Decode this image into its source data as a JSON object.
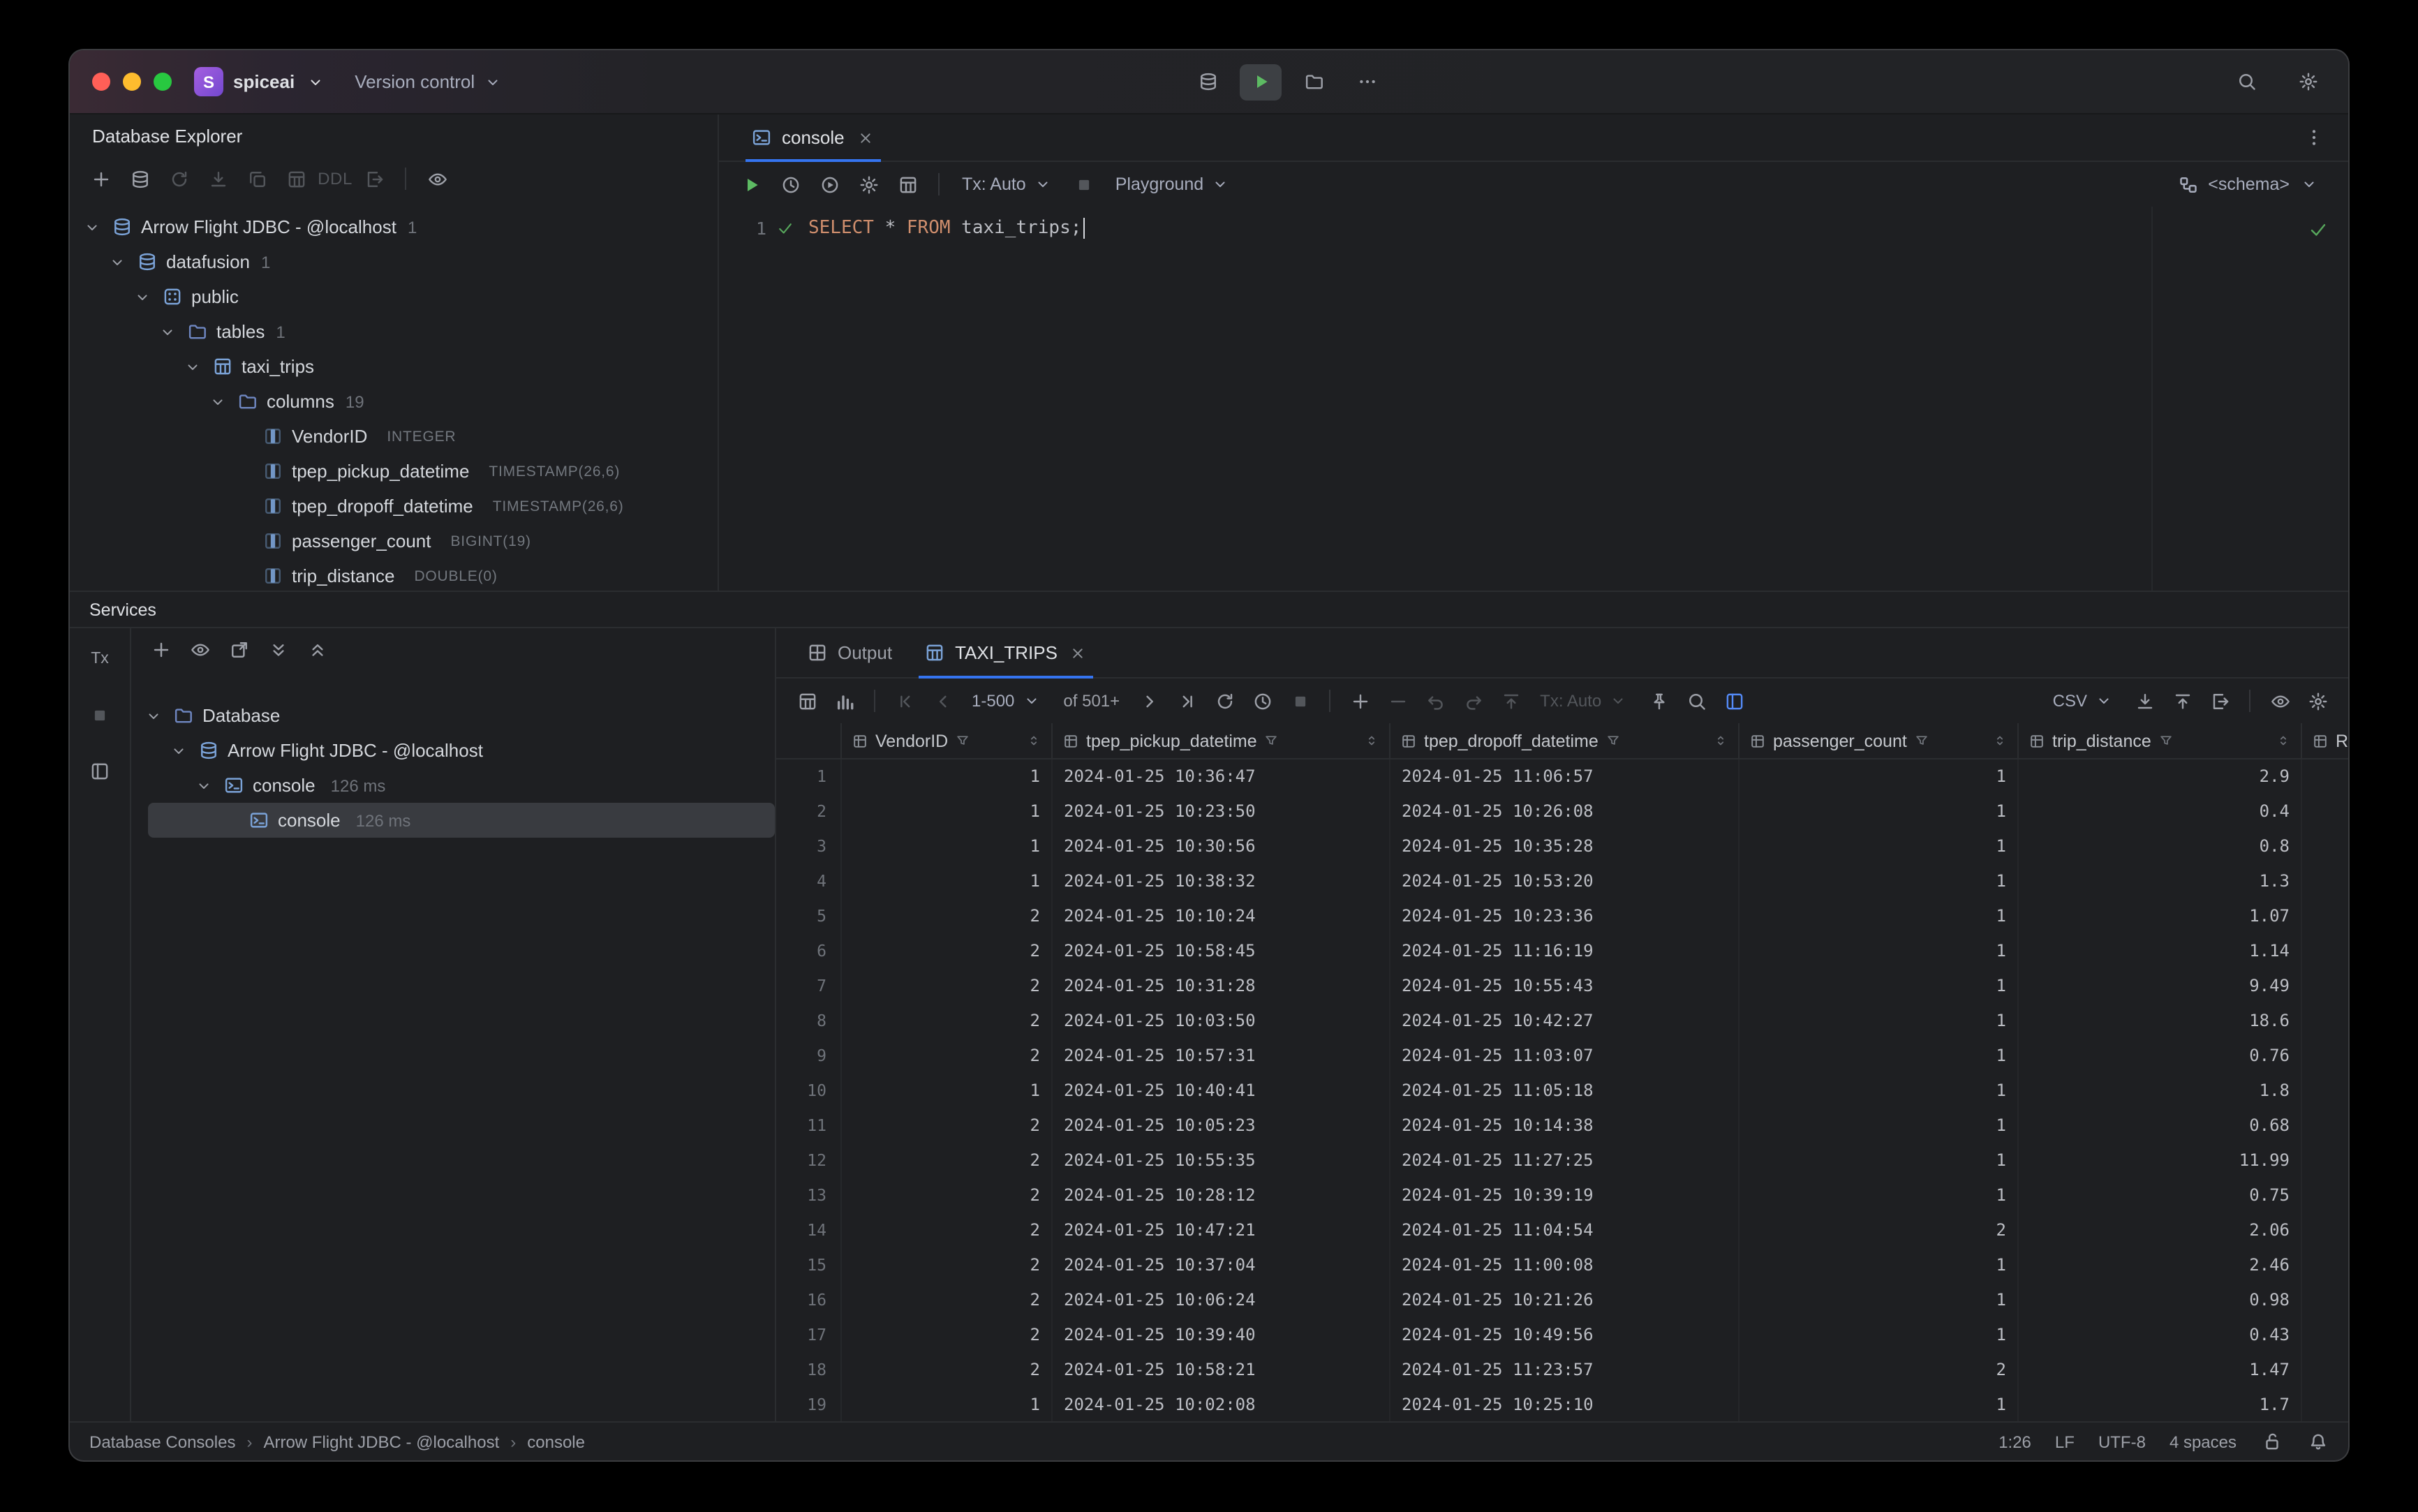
{
  "titlebar": {
    "project_initial": "S",
    "project_name": "spiceai",
    "version_control": "Version control"
  },
  "database_explorer": {
    "title": "Database Explorer",
    "toolbar": {
      "ddl": "DDL"
    },
    "tree": [
      {
        "icon": "db",
        "label": "Arrow Flight JDBC - @localhost",
        "badge": "1",
        "level": 0,
        "expanded": true
      },
      {
        "icon": "db",
        "label": "datafusion",
        "badge": "1",
        "level": 1,
        "expanded": true
      },
      {
        "icon": "schema",
        "label": "public",
        "level": 2,
        "expanded": true
      },
      {
        "icon": "folder",
        "label": "tables",
        "badge": "1",
        "level": 3,
        "expanded": true
      },
      {
        "icon": "table",
        "label": "taxi_trips",
        "level": 4,
        "expanded": true
      },
      {
        "icon": "folder",
        "label": "columns",
        "badge": "19",
        "level": 5,
        "expanded": true
      },
      {
        "icon": "column",
        "label": "VendorID",
        "type": "INTEGER",
        "level": 6
      },
      {
        "icon": "column",
        "label": "tpep_pickup_datetime",
        "type": "TIMESTAMP(26,6)",
        "level": 6
      },
      {
        "icon": "column",
        "label": "tpep_dropoff_datetime",
        "type": "TIMESTAMP(26,6)",
        "level": 6
      },
      {
        "icon": "column",
        "label": "passenger_count",
        "type": "BIGINT(19)",
        "level": 6
      },
      {
        "icon": "column",
        "label": "trip_distance",
        "type": "DOUBLE(0)",
        "level": 6
      }
    ]
  },
  "editor": {
    "tab": "console",
    "toolbar": {
      "tx": "Tx: Auto",
      "playground": "Playground",
      "schema": "<schema>"
    },
    "line_number": "1",
    "code": {
      "kw1": "SELECT",
      "op": " * ",
      "kw2": "FROM",
      "ident": " taxi_trips",
      "semi": ";"
    }
  },
  "services": {
    "title": "Services",
    "strip_tx": "Tx",
    "tree": [
      {
        "icon": "folder",
        "label": "Database",
        "level": 0,
        "expanded": true
      },
      {
        "icon": "db",
        "label": "Arrow Flight JDBC - @localhost",
        "level": 1,
        "expanded": true
      },
      {
        "icon": "terminal",
        "label": "console",
        "meta": "126 ms",
        "level": 2,
        "expanded": true
      },
      {
        "icon": "terminal",
        "label": "console",
        "meta": "126 ms",
        "level": 3,
        "selected": true
      }
    ]
  },
  "results": {
    "tabs": {
      "output": "Output",
      "result": "TAXI_TRIPS"
    },
    "toolbar": {
      "page": "1-500",
      "of": "of 501+",
      "tx": "Tx: Auto",
      "format": "CSV"
    },
    "grid": {
      "columns": [
        {
          "label": "VendorID",
          "align": "right"
        },
        {
          "label": "tpep_pickup_datetime",
          "align": "left"
        },
        {
          "label": "tpep_dropoff_datetime",
          "align": "left"
        },
        {
          "label": "passenger_count",
          "align": "right"
        },
        {
          "label": "trip_distance",
          "align": "right"
        },
        {
          "label": "Rate",
          "align": "left"
        }
      ],
      "rows": [
        [
          "1",
          "2024-01-25 10:36:47",
          "2024-01-25 11:06:57",
          "1",
          "2.9"
        ],
        [
          "1",
          "2024-01-25 10:23:50",
          "2024-01-25 10:26:08",
          "1",
          "0.4"
        ],
        [
          "1",
          "2024-01-25 10:30:56",
          "2024-01-25 10:35:28",
          "1",
          "0.8"
        ],
        [
          "1",
          "2024-01-25 10:38:32",
          "2024-01-25 10:53:20",
          "1",
          "1.3"
        ],
        [
          "2",
          "2024-01-25 10:10:24",
          "2024-01-25 10:23:36",
          "1",
          "1.07"
        ],
        [
          "2",
          "2024-01-25 10:58:45",
          "2024-01-25 11:16:19",
          "1",
          "1.14"
        ],
        [
          "2",
          "2024-01-25 10:31:28",
          "2024-01-25 10:55:43",
          "1",
          "9.49"
        ],
        [
          "2",
          "2024-01-25 10:03:50",
          "2024-01-25 10:42:27",
          "1",
          "18.6"
        ],
        [
          "2",
          "2024-01-25 10:57:31",
          "2024-01-25 11:03:07",
          "1",
          "0.76"
        ],
        [
          "1",
          "2024-01-25 10:40:41",
          "2024-01-25 11:05:18",
          "1",
          "1.8"
        ],
        [
          "2",
          "2024-01-25 10:05:23",
          "2024-01-25 10:14:38",
          "1",
          "0.68"
        ],
        [
          "2",
          "2024-01-25 10:55:35",
          "2024-01-25 11:27:25",
          "1",
          "11.99"
        ],
        [
          "2",
          "2024-01-25 10:28:12",
          "2024-01-25 10:39:19",
          "1",
          "0.75"
        ],
        [
          "2",
          "2024-01-25 10:47:21",
          "2024-01-25 11:04:54",
          "2",
          "2.06"
        ],
        [
          "2",
          "2024-01-25 10:37:04",
          "2024-01-25 11:00:08",
          "1",
          "2.46"
        ],
        [
          "2",
          "2024-01-25 10:06:24",
          "2024-01-25 10:21:26",
          "1",
          "0.98"
        ],
        [
          "2",
          "2024-01-25 10:39:40",
          "2024-01-25 10:49:56",
          "1",
          "0.43"
        ],
        [
          "2",
          "2024-01-25 10:58:21",
          "2024-01-25 11:23:57",
          "2",
          "1.47"
        ],
        [
          "1",
          "2024-01-25 10:02:08",
          "2024-01-25 10:25:10",
          "1",
          "1.7"
        ]
      ]
    }
  },
  "statusbar": {
    "breadcrumbs": [
      "Database Consoles",
      "Arrow Flight JDBC - @localhost",
      "console"
    ],
    "caret": "1:26",
    "line_sep": "LF",
    "encoding": "UTF-8",
    "indent": "4 spaces"
  }
}
